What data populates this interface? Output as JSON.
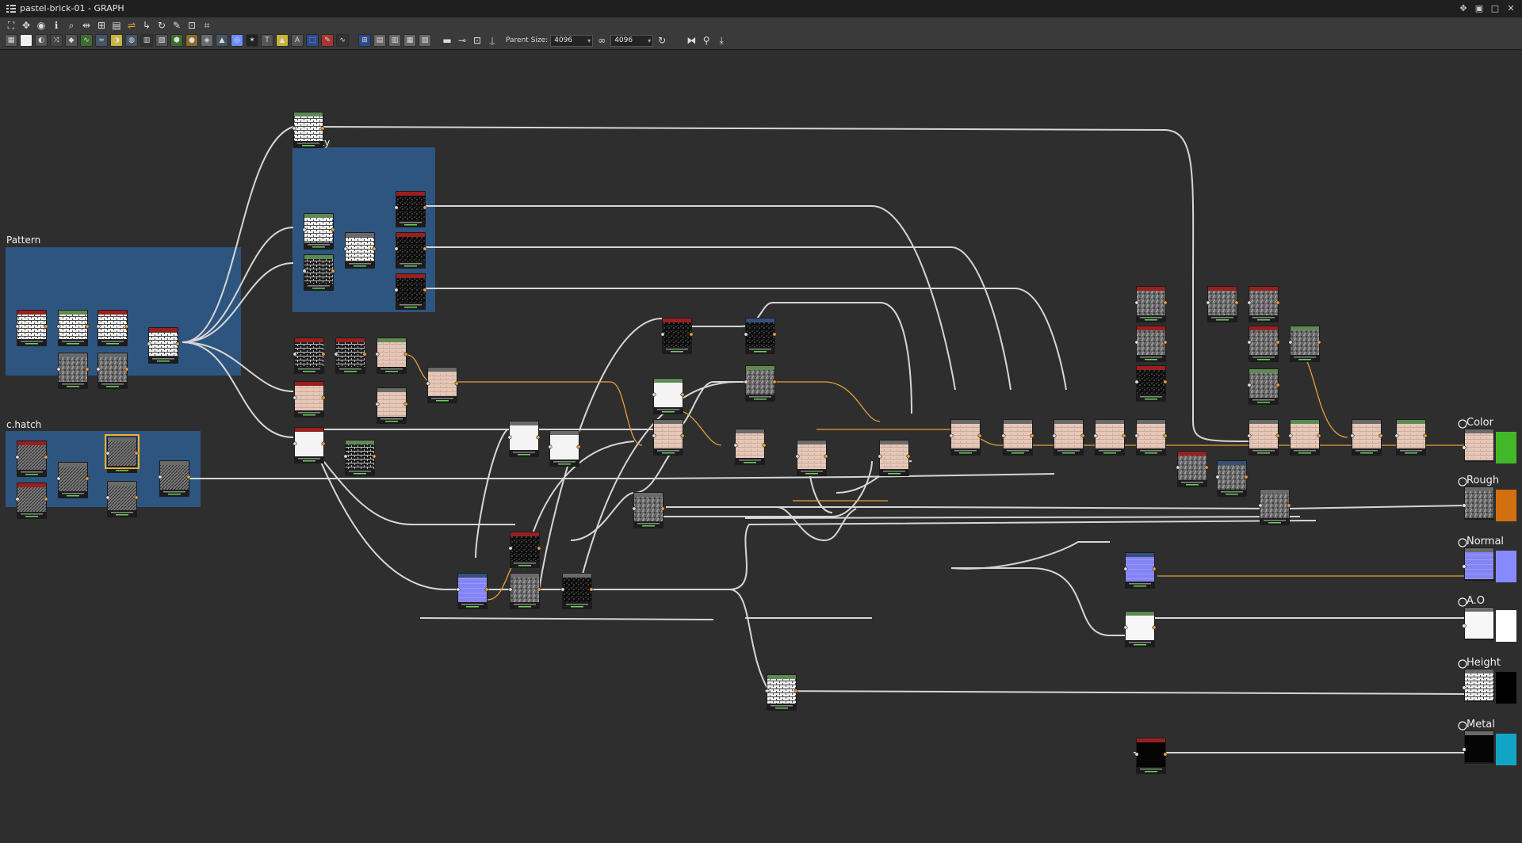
{
  "window": {
    "title": "pastel-brick-01 - GRAPH",
    "controls": [
      "pin-icon",
      "restore-icon",
      "maximize-icon",
      "close-icon"
    ]
  },
  "toolbar": {
    "parent_size_label": "Parent Size:",
    "parent_size_value": "4096",
    "linked_size_value": "4096",
    "row1_icons": [
      "frame-icon",
      "move-icon",
      "camera-icon",
      "info-icon",
      "search-icon",
      "align-icon",
      "layout-icon",
      "flow-icon",
      "link-icon",
      "reroute-icon",
      "reset-icon",
      "wrench-icon",
      "pin-node-icon",
      "crop-icon"
    ],
    "row2_icons": [
      "bitmap-icon",
      "uniform-icon",
      "gradient-icon",
      "shuffle-icon",
      "fill-icon",
      "curve-icon",
      "warp-icon",
      "blend-icon",
      "hsl-icon",
      "levels-icon",
      "grayscale-icon",
      "normal-icon",
      "blur-icon",
      "sharpen-icon",
      "histogram-icon",
      "distance-icon",
      "tile-icon",
      "text-icon",
      "transform-icon",
      "emboss-icon",
      "mask-icon",
      "svg-icon",
      "view-icon",
      "view2-icon",
      "view3-icon",
      "view4-icon",
      "comment-icon",
      "connect-icon",
      "link-slot-icon",
      "pin-icon"
    ]
  },
  "frames": [
    {
      "title": "s.cavity"
    },
    {
      "title": "Pattern"
    },
    {
      "title": "c.hatch"
    }
  ],
  "outputs": [
    {
      "label": "Color",
      "swatch": "#43b72a"
    },
    {
      "label": "Rough",
      "swatch": "#d07011"
    },
    {
      "label": "Normal",
      "swatch": "#8888ff"
    },
    {
      "label": "A.O",
      "swatch": "#ffffff"
    },
    {
      "label": "Height",
      "swatch": "#000000"
    },
    {
      "label": "Metal",
      "swatch": "#12a4c4"
    }
  ],
  "colors": {
    "canvas": "#2e2e2e",
    "frame": "#2e5a88",
    "wire": "#d6d6d6",
    "wire_active": "#e5a03c",
    "selected_outline": "#f0b030"
  }
}
